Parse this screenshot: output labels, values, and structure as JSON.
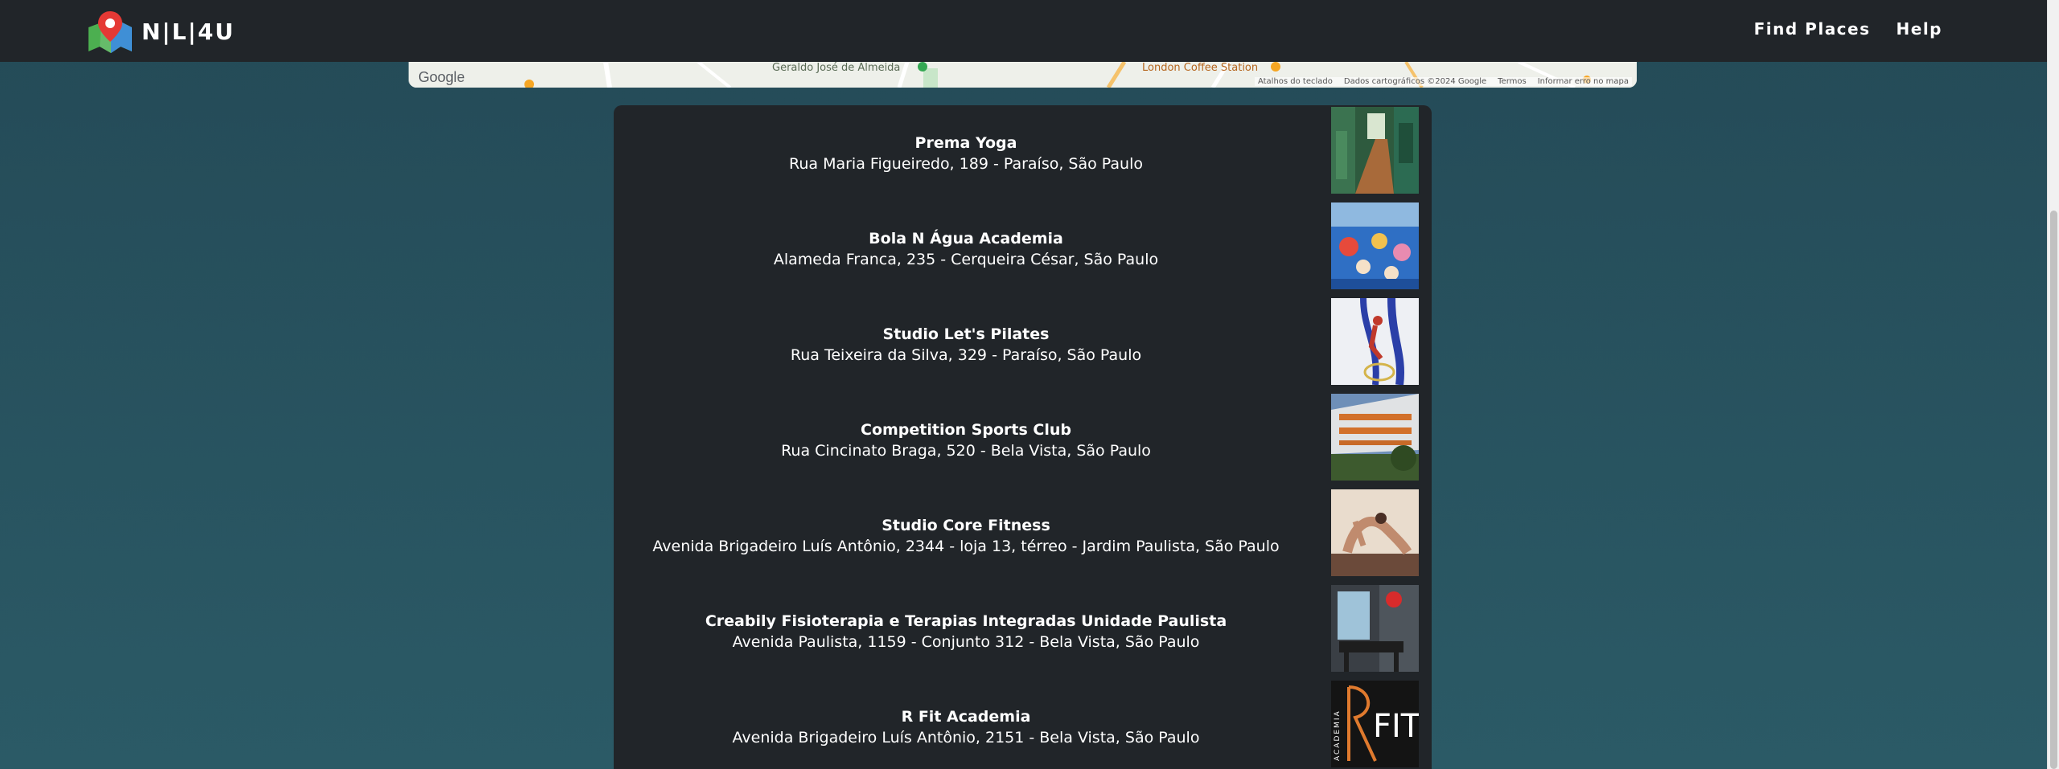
{
  "header": {
    "brand": "N|L|4U",
    "nav": [
      {
        "label": "Find Places"
      },
      {
        "label": "Help"
      }
    ]
  },
  "map": {
    "pois": [
      "Geraldo José de Almeida",
      "London Coffee Station"
    ],
    "attribution": {
      "shortcuts": "Atalhos do teclado",
      "data": "Dados cartográficos ©2024 Google",
      "terms": "Termos",
      "report": "Informar erro no mapa"
    },
    "logo": "Google"
  },
  "places": [
    {
      "name": "Prema Yoga",
      "address": "Rua Maria Figueiredo, 189 - Paraíso, São Paulo"
    },
    {
      "name": "Bola N Água Academia",
      "address": "Alameda Franca, 235 - Cerqueira César, São Paulo"
    },
    {
      "name": "Studio Let's Pilates",
      "address": "Rua Teixeira da Silva, 329 - Paraíso, São Paulo"
    },
    {
      "name": "Competition Sports Club",
      "address": "Rua Cincinato Braga, 520 - Bela Vista, São Paulo"
    },
    {
      "name": "Studio Core Fitness",
      "address": "Avenida Brigadeiro Luís Antônio, 2344 - loja 13, térreo - Jardim Paulista, São Paulo"
    },
    {
      "name": "Creabily Fisioterapia e Terapias Integradas Unidade Paulista",
      "address": "Avenida Paulista, 1159 - Conjunto 312 - Bela Vista, São Paulo"
    },
    {
      "name": "R Fit Academia",
      "address": "Avenida Brigadeiro Luís Antônio, 2151 - Bela Vista, São Paulo"
    }
  ],
  "thumb_logo": {
    "vertical": "ACADEMIA",
    "mark": "FIT"
  },
  "colors": {
    "header_bg": "#212529",
    "card_bg": "#212529",
    "page_bg": "#2b5a66",
    "accent_orange": "#e07a2e"
  }
}
